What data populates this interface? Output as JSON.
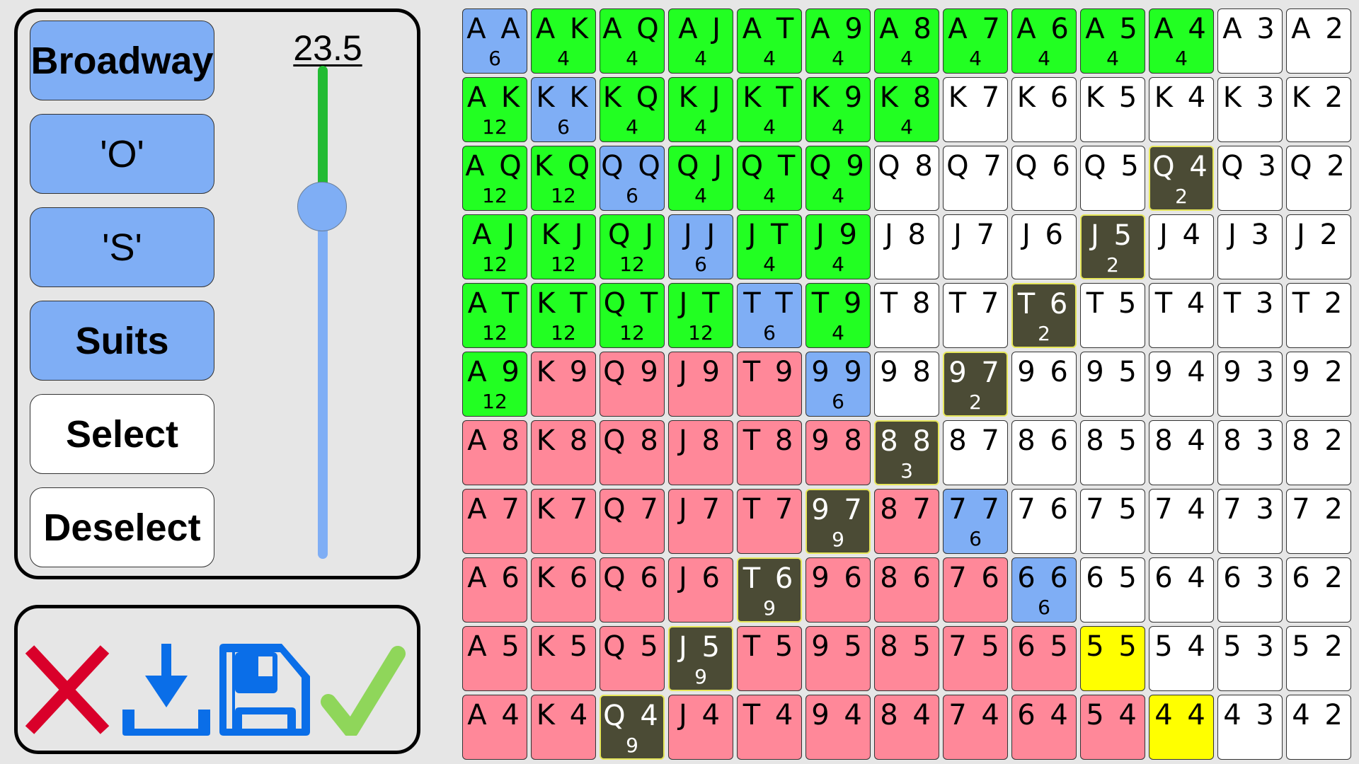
{
  "control_panel": {
    "buttons": [
      {
        "label": "Broadway",
        "style": "blue"
      },
      {
        "label": "'O'",
        "style": "blue"
      },
      {
        "label": "'S'",
        "style": "blue"
      },
      {
        "label": "Suits",
        "style": "blue"
      },
      {
        "label": "Select",
        "style": "white"
      },
      {
        "label": "Deselect",
        "style": "white"
      }
    ],
    "slider": {
      "value_label": "23.5",
      "fraction_from_top": 0.285
    }
  },
  "action_panel": {
    "icons": [
      "close-icon",
      "download-icon",
      "save-icon",
      "check-icon"
    ]
  },
  "colors": {
    "g": "#22ff22",
    "b": "#7faef5",
    "p": "#ff8899",
    "w": "#ffffff",
    "d": "#4b4b35",
    "y": "#ffff00"
  },
  "grid": {
    "ranks": [
      "A",
      "K",
      "Q",
      "J",
      "T",
      "9",
      "8",
      "7",
      "6",
      "5",
      "4",
      "3",
      "2"
    ],
    "rows": [
      [
        "b6",
        "g4",
        "g4",
        "g4",
        "g4",
        "g4",
        "g4",
        "g4",
        "g4",
        "g4",
        "g4",
        "w",
        "w"
      ],
      [
        "g12",
        "b6",
        "g4",
        "g4",
        "g4",
        "g4",
        "g4",
        "w",
        "w",
        "w",
        "w",
        "w",
        "w"
      ],
      [
        "g12",
        "g12",
        "b6",
        "g4",
        "g4",
        "g4",
        "w",
        "w",
        "w",
        "w",
        "d2",
        "w",
        "w"
      ],
      [
        "g12",
        "g12",
        "g12",
        "b6",
        "g4",
        "g4",
        "w",
        "w",
        "w",
        "d2",
        "w",
        "w",
        "w"
      ],
      [
        "g12",
        "g12",
        "g12",
        "g12",
        "b6",
        "g4",
        "w",
        "w",
        "d2",
        "w",
        "w",
        "w",
        "w"
      ],
      [
        "g12",
        "p",
        "p",
        "p",
        "p",
        "b6",
        "w",
        "d2",
        "w",
        "w",
        "w",
        "w",
        "w"
      ],
      [
        "p",
        "p",
        "p",
        "p",
        "p",
        "p",
        "d3",
        "w",
        "w",
        "w",
        "w",
        "w",
        "w"
      ],
      [
        "p",
        "p",
        "p",
        "p",
        "p",
        "d9",
        "p",
        "b6",
        "w",
        "w",
        "w",
        "w",
        "w"
      ],
      [
        "p",
        "p",
        "p",
        "p",
        "d9",
        "p",
        "p",
        "p",
        "b6",
        "w",
        "w",
        "w",
        "w"
      ],
      [
        "p",
        "p",
        "p",
        "d9",
        "p",
        "p",
        "p",
        "p",
        "p",
        "y",
        "w",
        "w",
        "w"
      ],
      [
        "p",
        "p",
        "d9",
        "p",
        "p",
        "p",
        "p",
        "p",
        "p",
        "p",
        "y",
        "w",
        "w"
      ]
    ]
  }
}
